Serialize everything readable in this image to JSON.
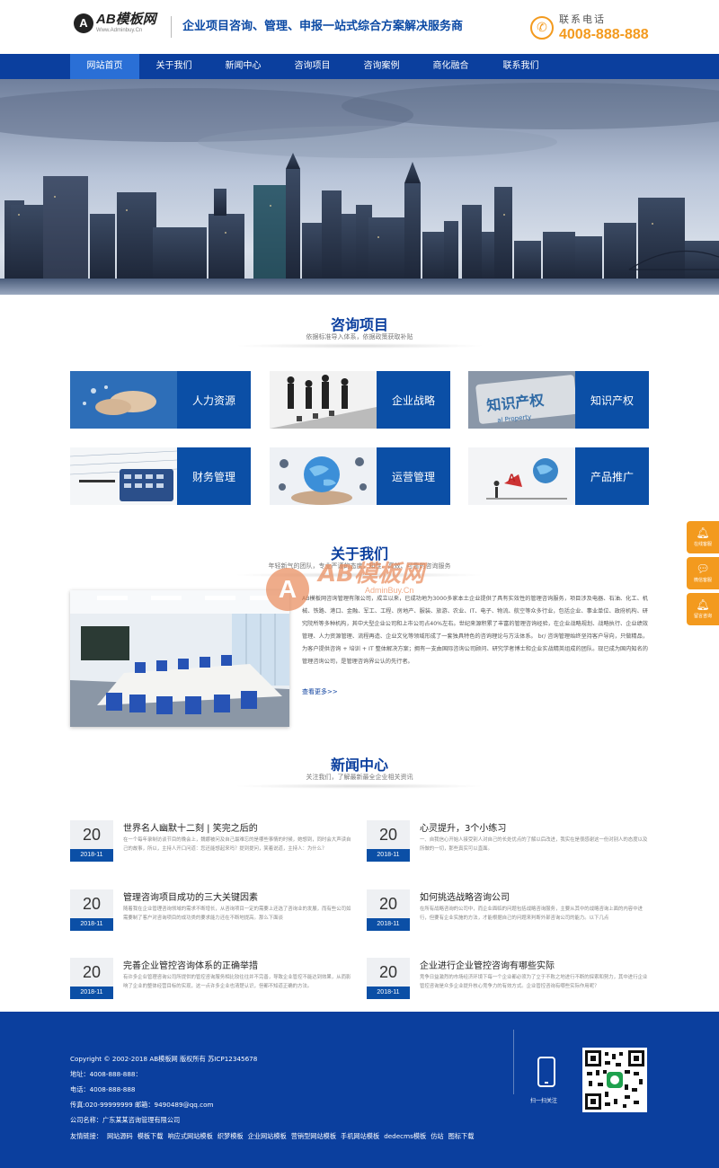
{
  "header": {
    "logo_mark": "A",
    "logo_title": "AB模板网",
    "logo_url": "Www.Adminbuy.Cn",
    "slogan": "企业项目咨询、管理、申报一站式综合方案解决服务商",
    "phone_label": "联系电话",
    "phone_number": "4008-888-888",
    "phone_icon": "phone-icon"
  },
  "nav": {
    "items": [
      "网站首页",
      "关于我们",
      "新闻中心",
      "咨询项目",
      "咨询案例",
      "商化融合",
      "联系我们"
    ],
    "active_index": 0
  },
  "colors": {
    "primary": "#0b3f9e",
    "accent": "#f39a1e",
    "nav_active": "#2a6fd6"
  },
  "services": {
    "title": "咨询项目",
    "subtitle": "依据标准导入体系，依据政策获取补贴",
    "items": [
      {
        "label": "人力资源",
        "image": "handshake-image"
      },
      {
        "label": "企业战略",
        "image": "chess-business-image"
      },
      {
        "label": "知识产权",
        "image": "ip-sign-image"
      },
      {
        "label": "财务管理",
        "image": "calculator-image"
      },
      {
        "label": "运营管理",
        "image": "globe-hands-image"
      },
      {
        "label": "产品推广",
        "image": "marketing-image"
      }
    ]
  },
  "about": {
    "title": "关于我们",
    "subtitle": "年轻新气的团队，专业严谨的态度，知性、高效、可靠的咨询服务",
    "text": "AB模板网咨询管理有限公司，成立以来，已成功地为3000多家本土企业提供了具有实效性的管理咨询服务，项目涉及电器、石油、化工、机械、铁路、港口、金融、军工、工程、房地产、服装、旅游、农业、IT、电子、物流、航空等众多行业，包括企业、事业单位、政府机构、研究院所等多种机构，其中大型企业公司和上市公司占40%左右。世纪来源积累了丰富的管理咨询经验，在企业战略规划、战略执行、企业绩效管理、人力资源管理、流程再造、企业文化等领域形成了一套独具特色的咨询理论与方法体系。 br/ 咨询管理始终坚持客户导向，只做精品，为客户提供咨询 + 培训 + IT 整体解决方案；拥有一支由国际咨询公司顾问、研究学者博士和企业实战精英组成的团队。现已成为国内知名的管理咨询公司，是管理咨询界公认的先行者。",
    "more": "查看更多>>",
    "watermark_mark": "A",
    "watermark_text": "AB模板网",
    "watermark_url": "AdminBuy.Cn"
  },
  "news": {
    "title": "新闻中心",
    "subtitle": "关注我们，了解最新最全企业相关资讯",
    "items": [
      {
        "day": "20",
        "month": "2018-11",
        "title": "世界名人幽默十二刻 | 笑完之后的",
        "desc": "在一个每年录制访谈节目的晚会上，魏娜被问及自己最难忘的是哪些事情的时候，她想到，同时会大声读自己的故事，所以，主持人开口问道：您还能想起来吗？提到提问，笑着说道，主持人：为什么？"
      },
      {
        "day": "20",
        "month": "2018-11",
        "title": "心灵提升，3个小练习",
        "desc": "一、自我信心开始人接受别人对自己的长处优点的了解以后改进，我实在是很感谢这一份对别人的态度以及所做的一切，那些真实可以直面。"
      },
      {
        "day": "20",
        "month": "2018-11",
        "title": "管理咨询项目成功的三大关键因素",
        "desc": "随着我在企业管理咨询领域的需求不断增长，从咨询项目一定的需要上还选了咨询业的发展，而有些公司如需要制了客户对咨询项目的成功类的要求能力还在不断地提高。那么下面谈"
      },
      {
        "day": "20",
        "month": "2018-11",
        "title": "如何挑选战略咨询公司",
        "desc": "在所有战略咨询的公司中，而企业面临的问题包括战略咨询服务，主要从其中的战略咨询上面的内容中进行，但要有企业实施的方法，才能根据自己的问题来判断外部咨询公司的能力。以下几点"
      },
      {
        "day": "20",
        "month": "2018-11",
        "title": "完善企业管控咨询体系的正确举措",
        "desc": "有许多企业管理咨询公司所提供的管控咨询服务相比较往往并不完善，导致企业管控不能达到效果，从而影响了企业的整体经营目标的实现，这一点许多企业也清楚认识，但都不知道正确的方法。"
      },
      {
        "day": "20",
        "month": "2018-11",
        "title": "企业进行企业管控咨询有哪些实际",
        "desc": "竞争日益激烈的市场经济环境下每一个企业都必须为了立于不败之地进行不断的探索和努力，其中进行企业管控咨询是众多企业提升核心竞争力的有效方式。企业管控咨询有哪些实际作用呢？"
      }
    ]
  },
  "side_float": [
    {
      "icon": "bell-icon",
      "label": "在线客服"
    },
    {
      "icon": "chat-icon",
      "label": "微信客服"
    },
    {
      "icon": "bell-icon",
      "label": "留言咨询"
    }
  ],
  "footer": {
    "copyright": "Copyright © 2002-2018 AB模板网 版权所有   苏ICP12345678",
    "address": "地址：4008-888-888：",
    "phone": "电话：4008-888-888",
    "fax_email": "传真:020-99999999  邮箱：9490489@qq.com",
    "company": "公司名称：广东某某咨询管理有限公司",
    "links_label": "友情链接：",
    "links": [
      "网站源码",
      "模板下载",
      "响应式网站模板",
      "织梦模板",
      "企业网站模板",
      "营销型网站模板",
      "手机网站模板",
      "dedecms模板",
      "仿站",
      "图标下载"
    ],
    "scan_label": "扫一扫关注"
  }
}
